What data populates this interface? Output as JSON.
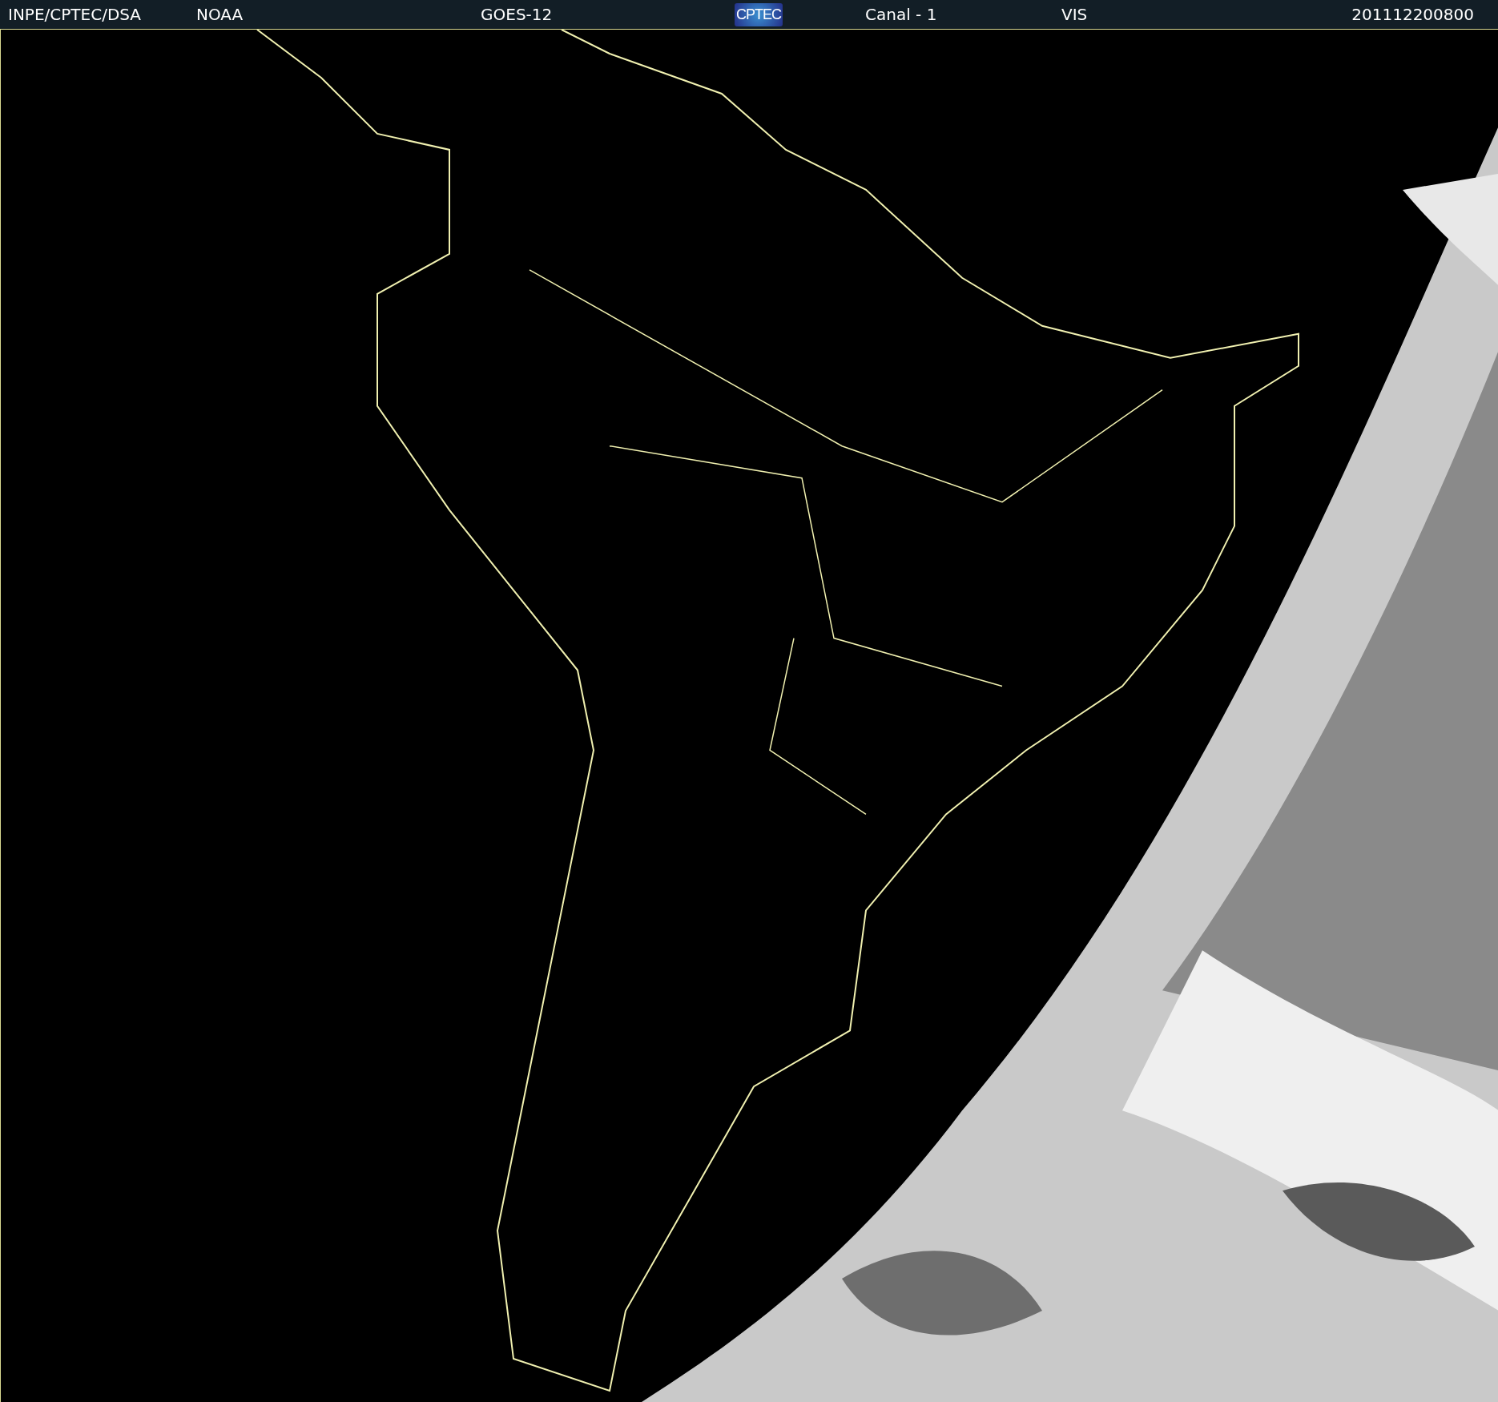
{
  "header": {
    "items": [
      {
        "kind": "text",
        "text": "INPE/CPTEC/DSA"
      },
      {
        "kind": "text",
        "text": "NOAA"
      },
      {
        "kind": "text",
        "text": "GOES-12"
      },
      {
        "kind": "logo",
        "text": "CPTEC"
      },
      {
        "kind": "text",
        "text": "Canal - 1"
      },
      {
        "kind": "text",
        "text": "VIS"
      },
      {
        "kind": "text",
        "text": "201112200800"
      }
    ]
  }
}
